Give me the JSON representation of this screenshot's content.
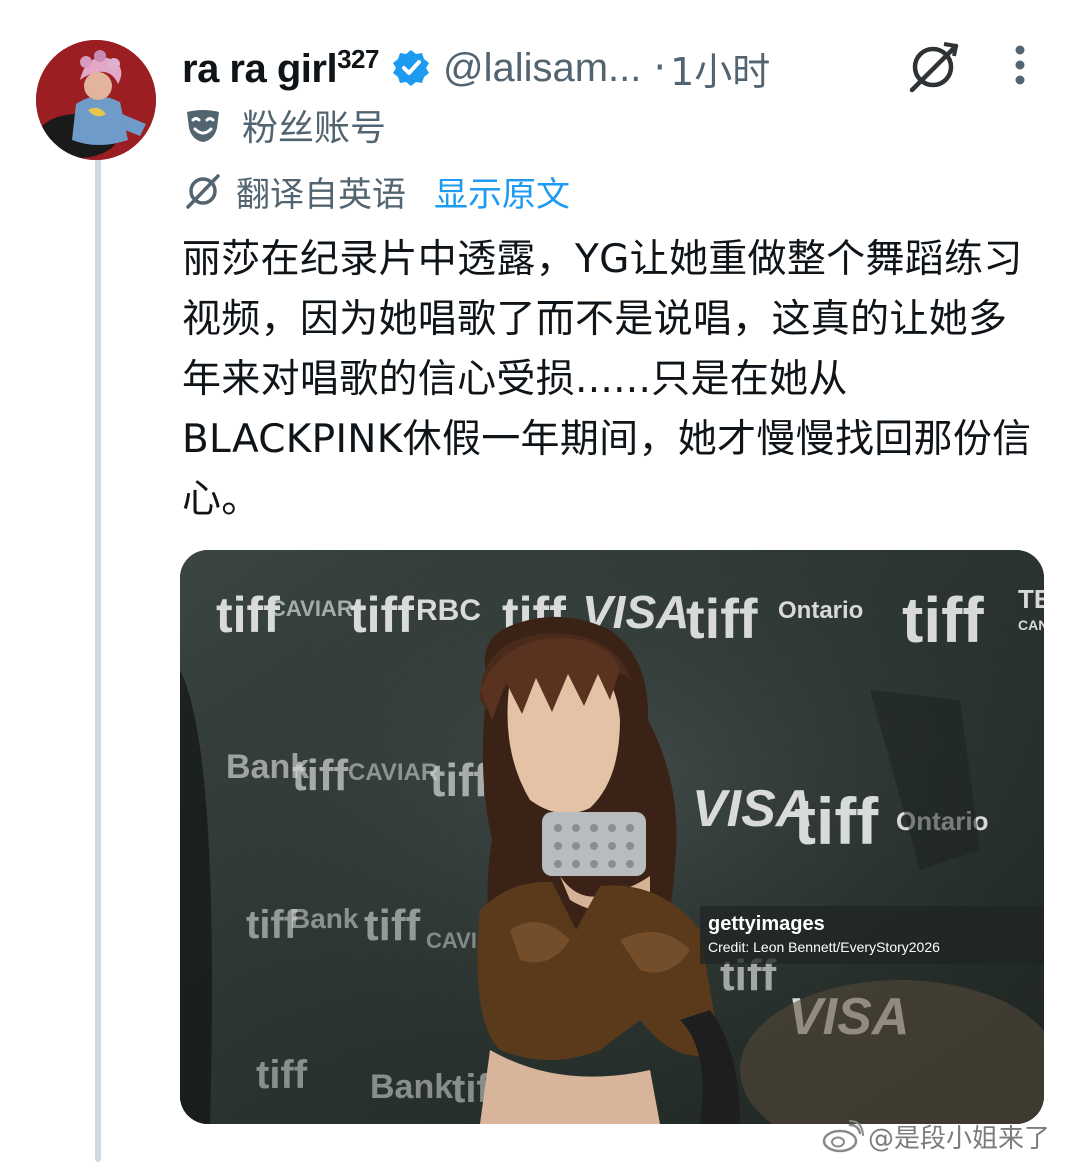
{
  "post": {
    "display_name": "ra ra girl",
    "display_name_superscript": "327",
    "handle": "@lalisam...",
    "separator": "·",
    "timestamp": "1小时",
    "account_label": "粉丝账号",
    "translated_label": "翻译自英语",
    "show_original": "显示原文",
    "body": "丽莎在纪录片中透露，YG让她重做整个舞蹈练习视频，因为她唱歌了而不是说唱，这真的让她多年来对唱歌的信心受损......只是在她从BLACKPINK休假一年期间，她才慢慢找回那份信心。"
  },
  "media": {
    "getty_logo": "gettyimages",
    "credit": "Credit: Leon Bennett/EveryStory2026",
    "backdrop_words": [
      "tiff",
      "VISA",
      "Ontario",
      "Royal Bank",
      "CAVIAR",
      "TE",
      "CAN"
    ]
  },
  "watermark": {
    "text": "@是段小姐来了"
  },
  "colors": {
    "accent": "#1d9bf0",
    "secondary_text": "#536471",
    "thread_line": "#cfd9de"
  },
  "icons": [
    "verified-badge-icon",
    "grok-translate-icon",
    "more-icon",
    "mask-icon",
    "translate-icon",
    "weibo-logo-icon"
  ]
}
